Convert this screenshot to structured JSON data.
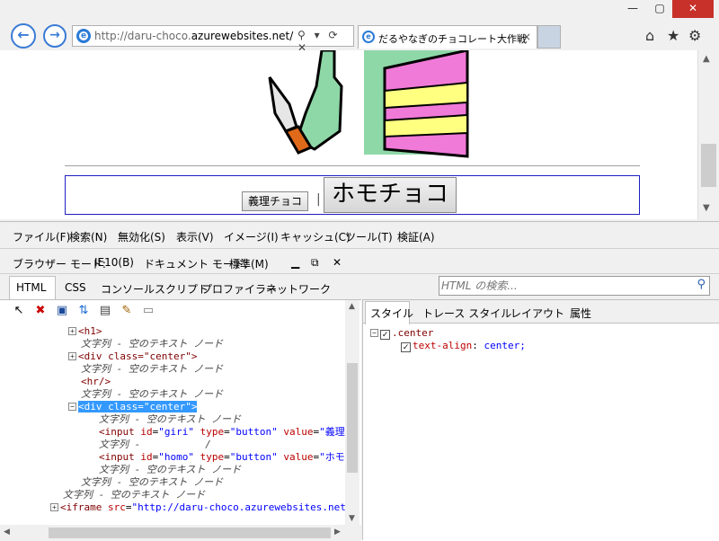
{
  "browser": {
    "address_url_prefix": "http://daru-choco.",
    "address_url_domain": "azurewebsites.net/",
    "address_controls": "⚲ ▾ ⟳ ✕",
    "tab_title": "だるやなぎのチョコレート大作戦",
    "tab_close": "×",
    "window_minimize": "—",
    "window_restore": "▢",
    "window_close": "✕",
    "back_icon": "←",
    "forward_icon": "→",
    "home_icon": "⌂",
    "favorites_icon": "★",
    "settings_icon": "⚙"
  },
  "page": {
    "giri_button": "義理チョコ",
    "separator": "|",
    "homo_button": "ホモチョコ"
  },
  "devtools": {
    "menu": [
      "ファイル(F)",
      "検索(N)",
      "無効化(S)",
      "表示(V)",
      "イメージ(I)",
      "キャッシュ(C)",
      "ツール(T)",
      "検証(A)"
    ],
    "browser_mode_label": "ブラウザー モード:",
    "browser_mode_value": "IE10(B)",
    "doc_mode_label": "ドキュメント モード:",
    "doc_mode_value": "標準(M)",
    "tabs": [
      "HTML",
      "CSS",
      "コンソール",
      "スクリプト",
      "プロファイラー",
      "ネットワーク"
    ],
    "search_placeholder": "HTML の検索...",
    "right_tabs": [
      "スタイル",
      "トレース スタイル",
      "レイアウト",
      "属性"
    ],
    "tree": {
      "h1": "<h1>",
      "text_empty": "文字列 - 空のテキスト ノード",
      "div_center": "<div class=\"center\">",
      "hr": "<hr/>",
      "div_sel_open": "<div",
      "div_sel_attr": "class",
      "div_sel_val": "\"center\"",
      "div_sel_close": ">",
      "text_slash_a": "文字列 -",
      "text_slash_b": "/",
      "input1_open": "<input",
      "input1_id": "id",
      "input1_id_val": "\"giri\"",
      "input1_type": "type",
      "input1_type_val": "\"button\"",
      "input1_value": "value",
      "input1_value_val": "\"義理チョ",
      "input2_open": "<input",
      "input2_id": "id",
      "input2_id_val": "\"homo\"",
      "input2_type": "type",
      "input2_type_val": "\"button\"",
      "input2_value": "value",
      "input2_value_val": "\"ホモチョ",
      "iframe_open": "<iframe",
      "iframe_src": "src",
      "iframe_src_val": "\"http://daru-choco.azurewebsites.net/sig"
    },
    "styles": {
      "selector": ".center",
      "prop": "text-align",
      "value": "center;"
    }
  }
}
